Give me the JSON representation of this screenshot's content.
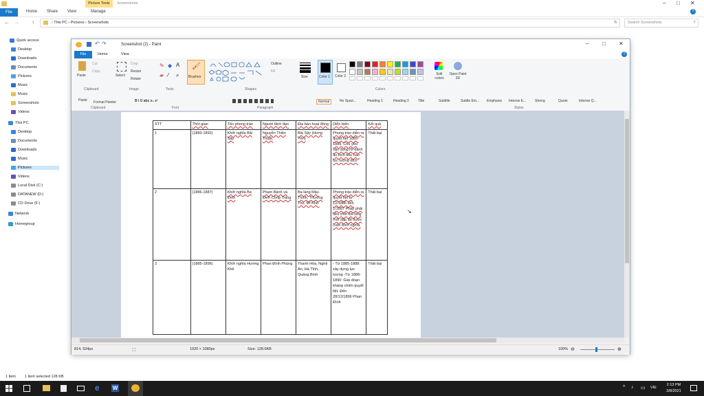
{
  "explorer": {
    "title_tabs": [
      "Picture Tools",
      "Screenshots"
    ],
    "ribbon_tabs": [
      "File",
      "Home",
      "Share",
      "View",
      "Manage"
    ],
    "breadcrumb": "›  This PC  ›  Pictures  ›  Screenshots",
    "search_placeholder": "Search Screenshots",
    "sidebar": [
      {
        "label": "Quick access",
        "color": "#3a7bd5"
      },
      {
        "label": "Desktop",
        "color": "#3a86d8"
      },
      {
        "label": "Downloads",
        "color": "#2b6cc4"
      },
      {
        "label": "Documents",
        "color": "#6a8fb5"
      },
      {
        "label": "Pictures",
        "color": "#4fa3e0"
      },
      {
        "label": "Music",
        "color": "#2b6cc4"
      },
      {
        "label": "Music",
        "color": "#e8c05a"
      },
      {
        "label": "Screenshots",
        "color": "#e8c05a"
      },
      {
        "label": "Videos",
        "color": "#6a4fb5"
      },
      {
        "label": "This PC",
        "color": "#3a86d8"
      },
      {
        "label": "Desktop",
        "color": "#3a86d8"
      },
      {
        "label": "Documents",
        "color": "#6a8fb5"
      },
      {
        "label": "Downloads",
        "color": "#2b6cc4"
      },
      {
        "label": "Music",
        "color": "#2b6cc4"
      },
      {
        "label": "Pictures",
        "color": "#4fa3e0"
      },
      {
        "label": "Videos",
        "color": "#6a4fb5"
      },
      {
        "label": "Local Disk (C:)",
        "color": "#8a8a8a"
      },
      {
        "label": "DATANEW (D:)",
        "color": "#8a8a8a"
      },
      {
        "label": "CD Drive (F:)",
        "color": "#8a8a8a"
      },
      {
        "label": "Network",
        "color": "#3a86d8"
      },
      {
        "label": "Homegroup",
        "color": "#2e9ad0"
      }
    ],
    "status_items": "1 item",
    "status_selected": "1 item selected  128 KB"
  },
  "paint": {
    "title": "Screenshot (2) - Paint",
    "tabs": [
      "File",
      "Home",
      "View"
    ],
    "ribbon": {
      "clipboard": {
        "paste": "Paste",
        "cut": "Cut",
        "copy": "Copy",
        "label": "Clipboard"
      },
      "image": {
        "select": "Select",
        "crop": "Crop",
        "resize": "Resize",
        "rotate": "Rotate",
        "label": "Image"
      },
      "tools": {
        "label": "Tools",
        "brushes": "Brushes"
      },
      "shapes": {
        "outline": "Outline",
        "fill": "Fill",
        "label": "Shapes"
      },
      "size": "Size",
      "color1": "Color 1",
      "color2": "Color 2",
      "colors_label": "Colors",
      "edit_colors": "Edit colors",
      "open3d": "Open Paint 3D"
    },
    "ribbon2": {
      "paste": "Paste",
      "format_painter": "Format Painter",
      "clipboard_label": "Clipboard",
      "font_buttons": "B  I  U  abc  x₂  x²",
      "font_label": "Font",
      "paragraph_label": "Paragraph",
      "styles": [
        "Normal",
        "No Spaci...",
        "Heading 1",
        "Heading 2",
        "Title",
        "Subtitle",
        "Subtle Em...",
        "Emphasis",
        "Intense E...",
        "Strong",
        "Quote",
        "Intense Q..."
      ],
      "styles_label": "Styles"
    },
    "status": {
      "pos": "814, 534px",
      "dims": "1920 × 1080px",
      "size": "Size: 128.6KB",
      "zoom": "100%"
    }
  },
  "table": {
    "headers": [
      "STT",
      "Thời gian",
      "Tên phong trào",
      "Người lãnh đạo",
      "Địa bàn hoạt động",
      "Diễn biến",
      "Kết quả"
    ],
    "rows": [
      [
        "1",
        "(1883-1892)",
        "Khởi nghĩa Bãi Sậy",
        "Nguyễn Thiện Thuật.",
        "Bãi Sậy (Hưng Yên)",
        "Phong trào diễn ra quyết liệt 1885-1889. Chủ yếu vận dụng lối đánh du kích tiêu hao lực lượng địch.",
        "Thất bại"
      ],
      [
        "2",
        "(1886-1887)",
        "Khởi nghĩa Ba Đình",
        "Phạm Bành và Đinh Công Tráng",
        "Ba làng Mậu Thịnh, Thượng Thọ, Mĩ Khê.",
        "Phong trào diễn ra quyết liệt từ 12/1886 đến 1/1887 Pháp phải tiêu chết dồi làng mới dập tắt được cuộc khởi nghĩa.",
        "Thất bại"
      ],
      [
        "3",
        "(1885-1896)",
        "Khởi nghĩa Hương Khê",
        "Phan Đình Phùng",
        "Thanh Hóa, Nghệ An, Hà Tĩnh, Quảng Bình",
        "- Từ 1885-1888: xây dựng lực lượng -Từ 1888-1890: Giai đoạn kháng chiến quyết liệt. Đến 28/12/1896 Phan Đình",
        "Thất bại"
      ]
    ]
  },
  "taskbar": {
    "time": "2:13 PM",
    "date": "3/8/2021",
    "lang": "VIE"
  },
  "colors": {
    "accent": "#1979ca",
    "picture_tools": "#ffe08a"
  }
}
